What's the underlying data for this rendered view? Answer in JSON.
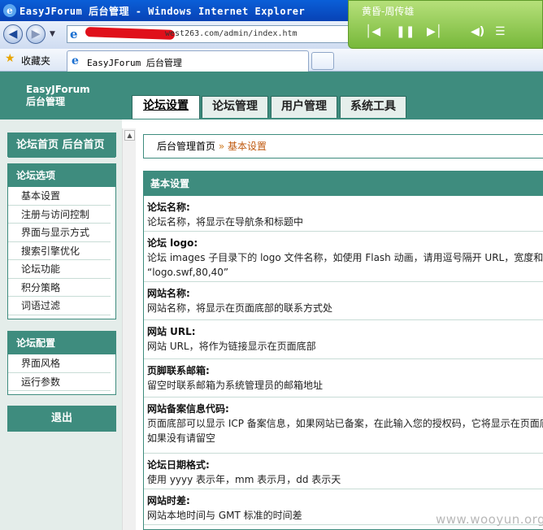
{
  "browser": {
    "title": "EasyJForum 后台管理 - Windows Internet Explorer",
    "address_url": "west263.com/admin/index.htm",
    "favorites_label": "收藏夹",
    "tab_label": "EasyJForum 后台管理"
  },
  "player": {
    "song": "黄昏-周传雄"
  },
  "header": {
    "brand_line1": "EasyJForum",
    "brand_line2": "后台管理",
    "tabs": [
      {
        "label": "论坛设置",
        "active": true
      },
      {
        "label": "论坛管理",
        "active": false
      },
      {
        "label": "用户管理",
        "active": false
      },
      {
        "label": "系统工具",
        "active": false
      }
    ]
  },
  "sidebar": {
    "home": "论坛首页 后台首页",
    "options": {
      "title": "论坛选项",
      "items": [
        "基本设置",
        "注册与访问控制",
        "界面与显示方式",
        "搜索引擎优化",
        "论坛功能",
        "积分策略",
        "词语过滤"
      ]
    },
    "config": {
      "title": "论坛配置",
      "items": [
        "界面风格",
        "运行参数"
      ]
    },
    "logout": "退出"
  },
  "breadcrumb": {
    "home": "后台管理首页",
    "separator": "»",
    "current": "基本设置"
  },
  "content": {
    "title": "基本设置",
    "rows": [
      {
        "key": "论坛名称:",
        "lines": [
          "论坛名称，将显示在导航条和标题中"
        ]
      },
      {
        "key": "论坛 logo:",
        "lines": [
          "论坛 images 子目录下的 logo 文件名称，如使用 Flash 动画，请用逗号隔开 URL，宽度和高",
          "“logo.swf,80,40”"
        ]
      },
      {
        "key": "网站名称:",
        "lines": [
          "网站名称，将显示在页面底部的联系方式处"
        ]
      },
      {
        "key": "网站 URL:",
        "lines": [
          "网站 URL，将作为链接显示在页面底部"
        ]
      },
      {
        "key": "页脚联系邮箱:",
        "lines": [
          "留空时联系邮箱为系统管理员的邮箱地址"
        ]
      },
      {
        "key": "网站备案信息代码:",
        "lines": [
          "页面底部可以显示 ICP 备案信息，如果网站已备案，在此输入您的授权码，它将显示在页面底",
          "如果没有请留空"
        ]
      },
      {
        "key": "论坛日期格式:",
        "lines": [
          "使用 yyyy 表示年，mm 表示月，dd 表示天"
        ]
      },
      {
        "key": "网站时差:",
        "lines": [
          "网站本地时间与 GMT 标准的时间差"
        ]
      }
    ]
  },
  "watermark": "www.wooyun.org"
}
